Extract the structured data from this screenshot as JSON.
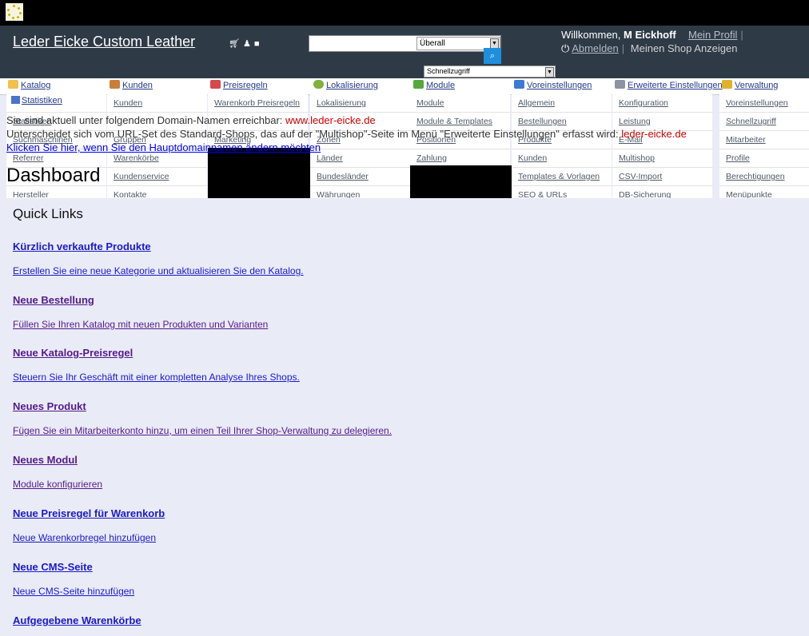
{
  "header": {
    "shop_name": "Leder Eicke Custom Leather",
    "search_scope": "Überall",
    "quick_access": "Schnellzugriff",
    "welcome_prefix": "Willkommen, ",
    "user_name": "M Eickhoff",
    "my_profile": "Mein Profil",
    "logout": "Abmelden",
    "view_shop": "Meinen Shop Anzeigen"
  },
  "menu": [
    {
      "label": "Katalog",
      "icon": "folder-icon"
    },
    {
      "label": "Kunden",
      "icon": "user-icon"
    },
    {
      "label": "Preisregeln",
      "icon": "price-tag-icon"
    },
    {
      "label": "Lokalisierung",
      "icon": "globe-icon"
    },
    {
      "label": "Module",
      "icon": "puzzle-icon"
    },
    {
      "label": "Voreinstellungen",
      "icon": "preferences-icon"
    },
    {
      "label": "Erweiterte Einstellungen",
      "icon": "wrench-icon"
    },
    {
      "label": "Verwaltung",
      "icon": "key-icon"
    }
  ],
  "submenus": {
    "catalog": [
      "",
      "Statistiken",
      "Suchmaschinen",
      "Referrer",
      "",
      "Hersteller"
    ],
    "customers": [
      "Kunden",
      "",
      "Gruppen",
      "Warenkörbe",
      "Kundenservice",
      "Kontakte"
    ],
    "price_rules": [
      "Warenkorb Preisregeln",
      "",
      "Marketing"
    ],
    "localization": [
      "Lokalisierung",
      "",
      "Zonen",
      "Länder",
      "Bundesländer",
      "Währungen"
    ],
    "modules": [
      "Module",
      "Module & Templates",
      "Positionen",
      "Zahlung"
    ],
    "preferences": [
      "Allgemein",
      "Bestellungen",
      "Produkte",
      "Kunden",
      "Templates & Vorlagen",
      "SEO & URLs"
    ],
    "advanced": [
      "Konfiguration",
      "Leistung",
      "E-Mail",
      "Multishop",
      "CSV-Import",
      "DB-Sicherung"
    ],
    "admin": [
      "Voreinstellungen",
      "Schnellzugriff",
      "Mitarbeiter",
      "Profile",
      "Berechtigungen",
      "Menüpunkte"
    ]
  },
  "overlay": {
    "stats_label": "Statistiken",
    "line1_text": "Sie sind aktuell unter folgendem Domain-Namen erreichbar: ",
    "line1_domain": "www.leder-eicke.de",
    "line2_text": "Unterscheidet sich vom URL-Set des Standard-Shops, das auf der \"Multishop\"-Seite im Menü \"Erweiterte Einstellungen\" erfasst wird: ",
    "line2_domain": "leder-eicke.de",
    "line3_link": "Klicken Sie hier, wenn Sie den Hauptdomainnamen ändern möchten"
  },
  "page_title": "Dashboard",
  "quick_links": {
    "title": "Quick Links",
    "items": [
      {
        "heading": "Kürzlich verkaufte Produkte",
        "text": "Erstellen Sie eine neue Kategorie und aktualisieren Sie den Katalog."
      },
      {
        "heading": "Neue Bestellung",
        "text": "Füllen Sie Ihren Katalog mit neuen Produkten und Varianten"
      },
      {
        "heading": "Neue Katalog-Preisregel",
        "text": "Steuern Sie Ihr Geschäft mit einer kompletten Analyse Ihres Shops."
      },
      {
        "heading": "Neues Produkt",
        "text": "Fügen Sie ein Mitarbeiterkonto hinzu, um einen Teil Ihrer Shop-Verwaltung zu delegieren."
      },
      {
        "heading": "Neues Modul",
        "text": "Module konfigurieren"
      },
      {
        "heading": "Neue Preisregel für Warenkorb",
        "text": "Neue Warenkorbregel hinzufügen"
      },
      {
        "heading": "Neue CMS-Seite",
        "text": "Neue CMS-Seite hinzufügen"
      },
      {
        "heading": "Aufgegebene Warenkörbe",
        "text": ""
      }
    ]
  }
}
